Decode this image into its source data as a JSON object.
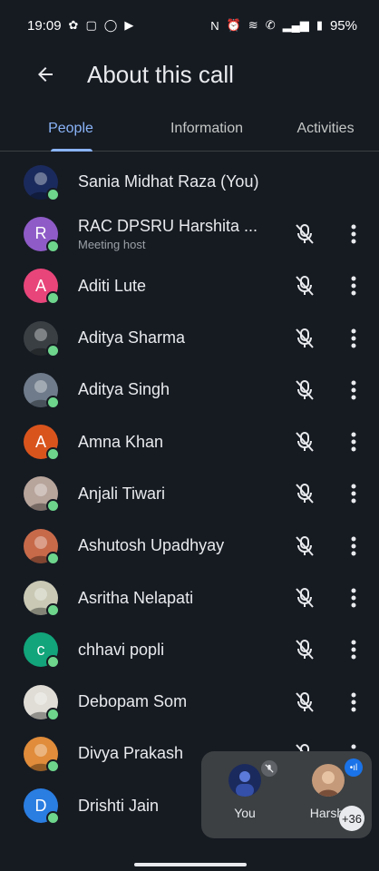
{
  "status_bar": {
    "time": "19:09",
    "battery": "95%",
    "icons_left": [
      "gear-icon",
      "cast-icon",
      "whatsapp-icon",
      "youtube-icon"
    ],
    "icons_right": [
      "nfc-icon",
      "alarm-icon",
      "wifi-icon",
      "call-icon",
      "signal-icon",
      "battery-icon"
    ]
  },
  "header": {
    "title": "About this call"
  },
  "tabs": [
    {
      "label": "People",
      "active": true
    },
    {
      "label": "Information",
      "active": false
    },
    {
      "label": "Activities",
      "active": false
    }
  ],
  "people": [
    {
      "name": "Sania Midhat Raza (You)",
      "subtitle": "",
      "avatar": "photo",
      "color": "#1b2a5c",
      "initial": "",
      "show_controls": false
    },
    {
      "name": "RAC DPSRU Harshita ...",
      "subtitle": "Meeting host",
      "avatar": "letter",
      "color": "#8e5bc7",
      "initial": "R",
      "show_controls": true
    },
    {
      "name": "Aditi Lute",
      "subtitle": "",
      "avatar": "letter",
      "color": "#e8457a",
      "initial": "A",
      "show_controls": true
    },
    {
      "name": "Aditya Sharma",
      "subtitle": "",
      "avatar": "photo",
      "color": "#3a3f44",
      "initial": "",
      "show_controls": true
    },
    {
      "name": "Aditya Singh",
      "subtitle": "",
      "avatar": "photo",
      "color": "#6f7b8a",
      "initial": "",
      "show_controls": true
    },
    {
      "name": "Amna Khan",
      "subtitle": "",
      "avatar": "letter",
      "color": "#d9541d",
      "initial": "A",
      "show_controls": true
    },
    {
      "name": "Anjali Tiwari",
      "subtitle": "",
      "avatar": "photo",
      "color": "#b7a49b",
      "initial": "",
      "show_controls": true
    },
    {
      "name": "Ashutosh Upadhyay",
      "subtitle": "",
      "avatar": "photo",
      "color": "#c76a4a",
      "initial": "",
      "show_controls": true
    },
    {
      "name": "Asritha Nelapati",
      "subtitle": "",
      "avatar": "photo",
      "color": "#c9c9b5",
      "initial": "",
      "show_controls": true
    },
    {
      "name": "chhavi popli",
      "subtitle": "",
      "avatar": "letter",
      "color": "#12a47a",
      "initial": "c",
      "show_controls": true
    },
    {
      "name": "Debopam Som",
      "subtitle": "",
      "avatar": "photo",
      "color": "#e0ddd6",
      "initial": "",
      "show_controls": true
    },
    {
      "name": "Divya Prakash",
      "subtitle": "",
      "avatar": "photo",
      "color": "#e08c3a",
      "initial": "",
      "show_controls": true
    },
    {
      "name": "Drishti Jain",
      "subtitle": "",
      "avatar": "letter",
      "color": "#2a7de1",
      "initial": "D",
      "show_controls": true
    }
  ],
  "pip": {
    "tiles": [
      {
        "label": "You",
        "color": "#1b2a5c"
      },
      {
        "label": "Harshi",
        "color": "#c49a7a"
      }
    ],
    "count": "+36"
  },
  "colors": {
    "accent": "#8ab4f8",
    "background": "#161b22",
    "presence": "#6dd58c"
  }
}
